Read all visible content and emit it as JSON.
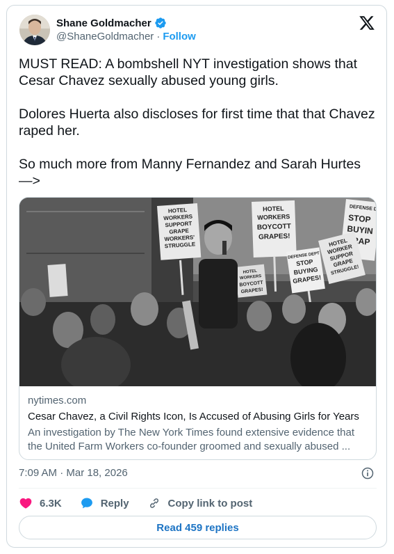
{
  "author": {
    "name": "Shane Goldmacher",
    "handle": "@ShaneGoldmacher",
    "separator": "·",
    "follow_label": "Follow",
    "verified_icon": "verified-badge-icon"
  },
  "tweet": {
    "paragraphs": [
      "MUST READ: A bombshell NYT investigation shows that Cesar Chavez sexually abused young girls.",
      "Dolores Huerta also discloses for first time that that Chavez raped her.",
      "So much more from Manny Fernandez and Sarah Hurtes —>"
    ],
    "timestamp": "7:09 AM · Mar 18, 2026"
  },
  "link_card": {
    "domain": "nytimes.com",
    "title": "Cesar Chavez, a Civil Rights Icon, Is Accused of Abusing Girls for Years",
    "description_line1": "An investigation by The New York Times found extensive evidence that",
    "description_line2": "the United Farm Workers co-founder groomed and sexually abused ...",
    "photo_signs": {
      "sign1": [
        "HOTEL",
        "WORKERS",
        "SUPPORT",
        "GRAPE",
        "WORKERS'",
        "STRUGGLE"
      ],
      "sign2": [
        "HOTEL",
        "WORKERS",
        "BOYCOTT",
        "GRAPES!"
      ],
      "sign3": [
        "DEFENSE DEPT",
        "STOP",
        "BUYING",
        "GRAPES!"
      ],
      "sign4": [
        "DEFENSE D",
        "STOP",
        "BUYIN",
        "GRAP"
      ],
      "sign5": [
        "HOTEL",
        "WORKER",
        "SUPPOR",
        "GRAPE",
        "STRUGGLE!"
      ],
      "sign6": [
        "HOTEL",
        "WORKERS",
        "BOYCOTT",
        "GRAPES!"
      ]
    }
  },
  "actions": {
    "likes": "6.3K",
    "reply_label": "Reply",
    "copy_label": "Copy link to post",
    "read_replies": "Read 459 replies"
  },
  "colors": {
    "accent": "#1d9bf0",
    "like": "#f91880",
    "muted": "#536471",
    "border": "#cfd9de"
  }
}
